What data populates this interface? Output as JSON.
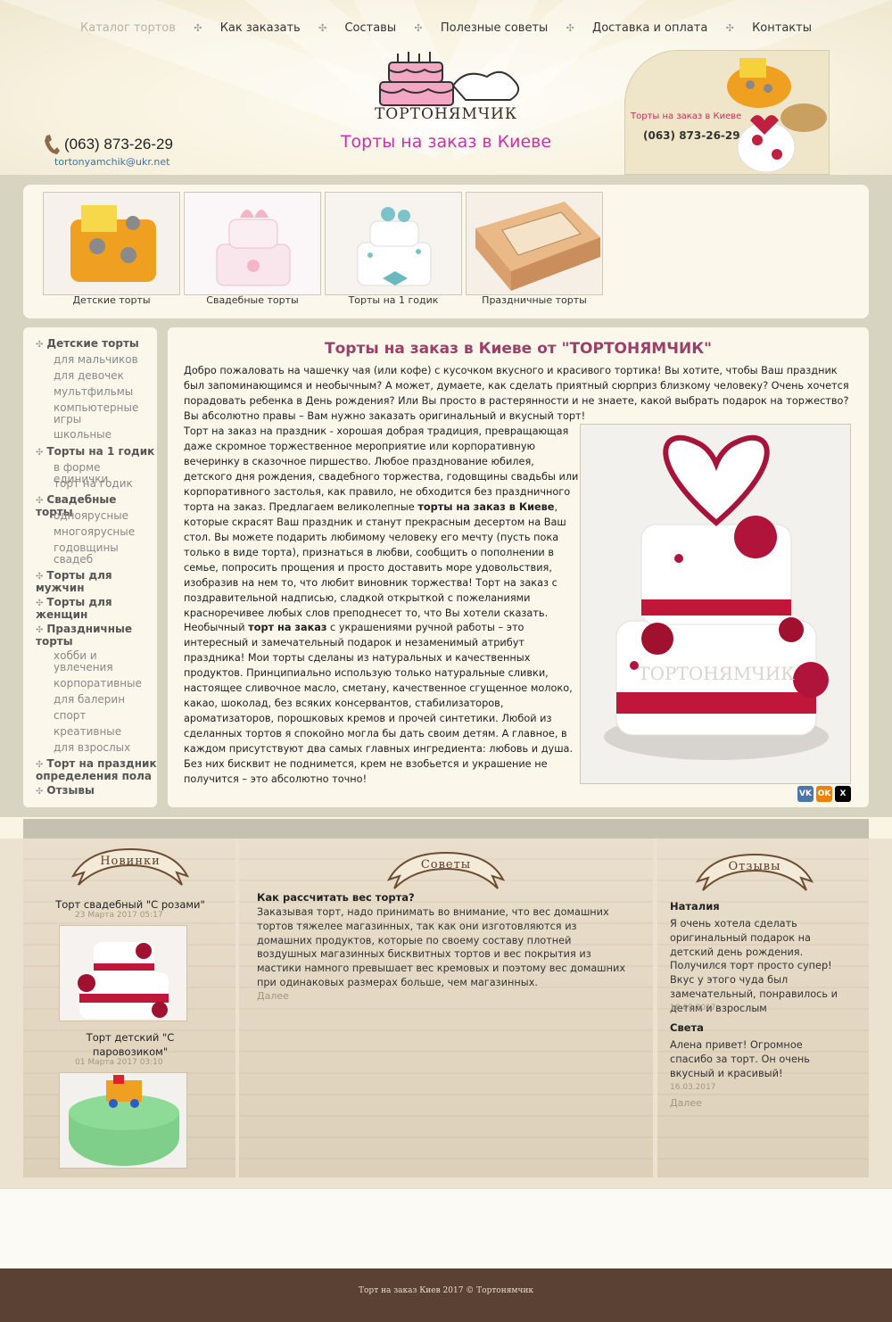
{
  "nav": {
    "items": [
      "Каталог тортов",
      "Как заказать",
      "Составы",
      "Полезные советы",
      "Доставка и оплата",
      "Контакты"
    ]
  },
  "header": {
    "phone": "(063) 873-26-29",
    "email": "tortonyamchik@ukr.net",
    "logo_text": "ТОРТОНЯМЧИК",
    "tagline": "Торты на заказ в Киеве",
    "banner_title": "Торты на заказ в Киеве",
    "banner_phone": "(063) 873-26-29"
  },
  "categories": [
    {
      "label": "Детские торты"
    },
    {
      "label": "Свадебные торты"
    },
    {
      "label": "Торты на 1 годик"
    },
    {
      "label": "Праздничные торты"
    }
  ],
  "sidebar": {
    "groups": [
      {
        "title": "Детские торты",
        "items": [
          "для мальчиков",
          "для девочек",
          "мультфильмы",
          "компьютерные игры",
          "школьные"
        ]
      },
      {
        "title": "Торты на 1 годик",
        "items": [
          "в форме единички",
          "торт на годик"
        ]
      },
      {
        "title": "Свадебные торты",
        "items": [
          "одноярусные",
          "многоярусные",
          "годовщины свадеб"
        ]
      },
      {
        "title": "Торты для мужчин",
        "items": []
      },
      {
        "title": "Торты для женщин",
        "items": []
      },
      {
        "title": "Праздничные торты",
        "items": [
          "хобби и увлечения",
          "корпоративные",
          "для балерин",
          "спорт",
          "креативные",
          "для взрослых"
        ]
      },
      {
        "title": "Торт на праздник определения пола",
        "items": []
      },
      {
        "title": "Отзывы",
        "items": []
      }
    ]
  },
  "main": {
    "title": "Торты на заказ в Киеве от \"ТОРТОНЯМЧИК\"",
    "intro": "Добро пожаловать на чашечку чая (или кофе) с кусочком вкусного и красивого тортика! Вы хотите, чтобы Ваш праздник был запоминающимся и необычным? А может, думаете, как сделать приятный сюрприз близкому человеку? Очень хочется порадовать ребенка в День рождения? Или Вы просто в растерянности и не знаете, какой выбрать подарок на торжество? Вы абсолютно правы – Вам нужно заказать оригинальный и вкусный торт!",
    "p2_a": "Торт на заказ на праздник - хорошая добрая традиция, превращающая даже скромное торжественное мероприятие или корпоративную вечеринку в сказочное пиршество. Любое празднование юбилея, детского дня рождения, свадебного торжества, годовщины свадьбы или корпоративного застолья, как правило, не обходится без праздничного торта на заказ. Предлагаем великолепные ",
    "p2_bold": "торты на заказ в Киеве",
    "p2_b": ", которые скрасят Ваш праздник и станут прекрасным десертом на Ваш стол. Вы можете подарить любимому человеку его мечту (пусть пока только в виде торта), признаться в любви, сообщить о пополнении в семье, попросить прощения и просто доставить море удовольствия, изобразив на нем то, что любит виновник торжества! Торт на заказ с поздравительной надписью, сладкой открыткой с пожеланиями красноречивее любых слов преподнесет то, что Вы хотели сказать.",
    "p3_a": "Необычный ",
    "p3_bold": "торт на заказ",
    "p3_b": " с украшениями ручной работы – это интересный и замечательный подарок и незаменимый атрибут праздника! Мои торты сделаны из натуральных и качественных продуктов. Принципиально использую только натуральные сливки, настоящее сливочное масло, сметану, качественное сгущенное молоко, какао, шоколад, без всяких консервантов, стабилизаторов, ароматизаторов, порошковых кремов и прочей синтетики. Любой из сделанных тортов я спокойно могла бы дать своим детям. А главное, в каждом присутствуют два самых главных ингредиента: любовь и душа. Без них бисквит не поднимется, крем не взобьется и украшение не получится – это абсолютно точно!",
    "image_watermark": "ТОРТОНЯМЧИК"
  },
  "share": {
    "vk": "VK",
    "ok": "OK",
    "x": "X"
  },
  "news": {
    "ribbon": "Новинки",
    "items": [
      {
        "title": "Торт свадебный \"С розами\"",
        "date": "23 Марта 2017 05:17"
      },
      {
        "title": "Торт детский \"С паровозиком\"",
        "date": "01 Марта 2017 03:10"
      }
    ]
  },
  "tips": {
    "ribbon": "Советы",
    "question": "Как рассчитать вес торта?",
    "text": "Заказывая торт, надо принимать во внимание, что вес домашних тортов тяжелее магазинных, так как они изготовляются из домашних продуктов, которые по своему составу плотней воздушных магазинных бисквитных тортов и вес покрытия из мастики намного превышает вес кремовых и поэтому вес домашних при одинаковых размерах больше, чем магазинных.",
    "more": "Далее"
  },
  "reviews": {
    "ribbon": "Отзывы",
    "items": [
      {
        "name": "Наталия",
        "text": "Я очень хотела сделать оригинальный подарок на детский день рождения. Получился торт просто супер! Вкус у этого чуда был замечательный, понравилось и детям и взрослым",
        "date": "18.03.2017"
      },
      {
        "name": "Света",
        "text": "Алена привет! Огромное спасибо за торт. Он очень вкусный и красивый!",
        "date": "16.03.2017"
      }
    ],
    "more": "Далее"
  },
  "footer": {
    "text": "Торт на заказ Киев 2017 © Тортонямчик"
  },
  "colors": {
    "accent": "#9b4068",
    "tagline": "#d22cb0",
    "footer": "#5a4133",
    "ribbon": "#c0325a"
  }
}
